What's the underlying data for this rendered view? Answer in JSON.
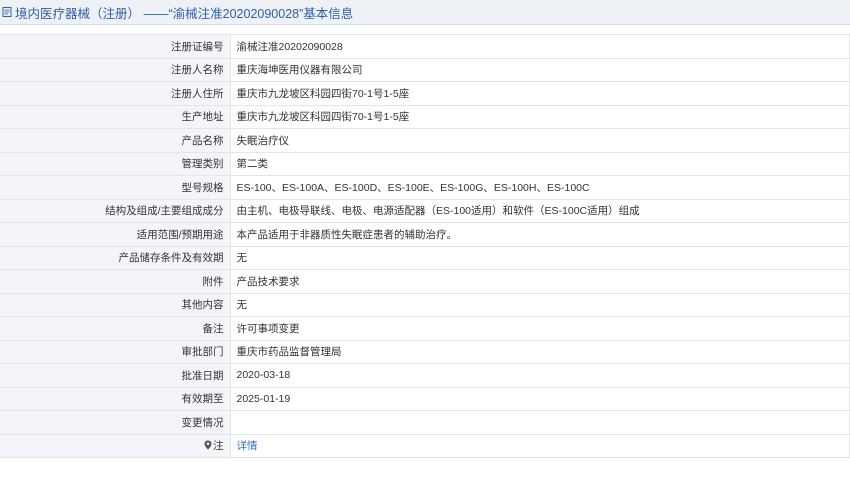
{
  "header": {
    "title": "境内医疗器械（注册） ——“渝械注准20202090028”基本信息"
  },
  "rows": [
    {
      "label": "注册证编号",
      "value": "渝械注准20202090028"
    },
    {
      "label": "注册人名称",
      "value": "重庆海坤医用仪器有限公司"
    },
    {
      "label": "注册人住所",
      "value": "重庆市九龙坡区科园四街70-1号1-5座"
    },
    {
      "label": "生产地址",
      "value": "重庆市九龙坡区科园四街70-1号1-5座"
    },
    {
      "label": "产品名称",
      "value": "失眠治疗仪"
    },
    {
      "label": "管理类别",
      "value": "第二类"
    },
    {
      "label": "型号规格",
      "value": "ES-100、ES-100A、ES-100D、ES-100E、ES-100G、ES-100H、ES-100C"
    },
    {
      "label": "结构及组成/主要组成成分",
      "value": "由主机、电极导联线、电极、电源适配器（ES-100适用）和软件（ES-100C适用）组成"
    },
    {
      "label": "适用范围/预期用途",
      "value": "本产品适用于非器质性失眠症患者的辅助治疗。"
    },
    {
      "label": "产品储存条件及有效期",
      "value": "无"
    },
    {
      "label": "附件",
      "value": "产品技术要求"
    },
    {
      "label": "其他内容",
      "value": "无"
    },
    {
      "label": "备注",
      "value": "许可事项变更"
    },
    {
      "label": "审批部门",
      "value": "重庆市药品监督管理局"
    },
    {
      "label": "批准日期",
      "value": "2020-03-18"
    },
    {
      "label": "有效期至",
      "value": "2025-01-19"
    },
    {
      "label": "变更情况",
      "value": ""
    }
  ],
  "note_row": {
    "label": "注",
    "link": "详情"
  }
}
